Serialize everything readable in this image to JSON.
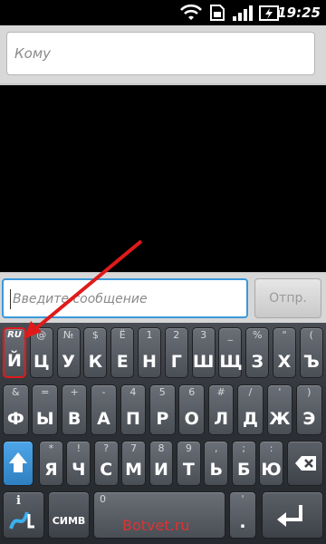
{
  "status_bar": {
    "time": "19:25",
    "icons": [
      "wifi-icon",
      "sim-icon",
      "signal-icon",
      "battery-charging-icon"
    ]
  },
  "recipient": {
    "placeholder": "Кому"
  },
  "compose": {
    "placeholder": "Введите сообщение",
    "send_label": "Отпр."
  },
  "keyboard": {
    "language": "RU",
    "row1": [
      {
        "main": "Й",
        "hint": "RU"
      },
      {
        "main": "Ц",
        "hint": "@"
      },
      {
        "main": "У",
        "hint": "№"
      },
      {
        "main": "К",
        "hint": "$"
      },
      {
        "main": "Е",
        "hint": "Ё"
      },
      {
        "main": "Н",
        "hint": "1"
      },
      {
        "main": "Г",
        "hint": "2"
      },
      {
        "main": "Ш",
        "hint": "3"
      },
      {
        "main": "Щ",
        "hint": "_"
      },
      {
        "main": "З",
        "hint": "%"
      },
      {
        "main": "Х",
        "hint": "\""
      },
      {
        "main": "Ъ",
        "hint": "("
      }
    ],
    "row2": [
      {
        "main": "Ф",
        "hint": "&"
      },
      {
        "main": "Ы",
        "hint": "="
      },
      {
        "main": "В",
        "hint": "+"
      },
      {
        "main": "А",
        "hint": "-"
      },
      {
        "main": "П",
        "hint": "4"
      },
      {
        "main": "Р",
        "hint": "5"
      },
      {
        "main": "О",
        "hint": "6"
      },
      {
        "main": "Л",
        "hint": "#"
      },
      {
        "main": "Д",
        "hint": "/"
      },
      {
        "main": "Ж",
        "hint": "'"
      },
      {
        "main": "Э",
        "hint": ")"
      }
    ],
    "row3": [
      {
        "main": "Я",
        "hint": "*"
      },
      {
        "main": "Ч",
        "hint": "!"
      },
      {
        "main": "С",
        "hint": "?"
      },
      {
        "main": "М",
        "hint": "7"
      },
      {
        "main": "И",
        "hint": "8"
      },
      {
        "main": "Т",
        "hint": "9"
      },
      {
        "main": "Ь",
        "hint": ","
      },
      {
        "main": "Б",
        "hint": ";"
      },
      {
        "main": "Ю",
        "hint": ":"
      }
    ],
    "row4": {
      "info_icon": "info-icon",
      "symb_label": "СИМВ",
      "zero_hint": "0",
      "space_label": "",
      "comma_hint": "'",
      "period": "."
    }
  },
  "watermark": "Botvet.ru",
  "colors": {
    "accent_focus": "#3b98d8",
    "annotation": "#e01a1a",
    "shift": "#2f7fc0"
  }
}
